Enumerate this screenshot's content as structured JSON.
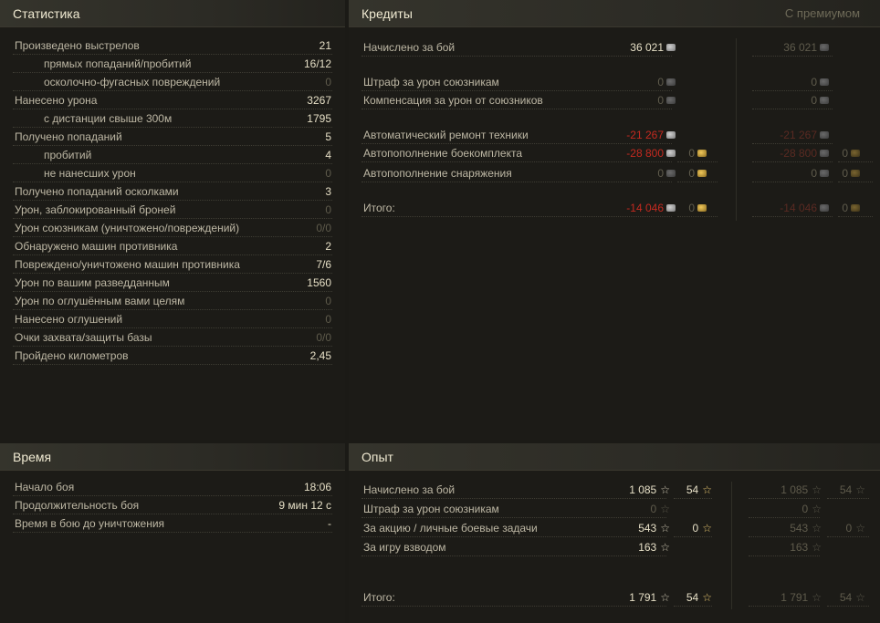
{
  "statistics": {
    "title": "Статистика",
    "rows": [
      {
        "label": "Произведено выстрелов",
        "value": "21",
        "sub": false,
        "zero": false
      },
      {
        "label": "прямых попаданий/пробитий",
        "value": "16/12",
        "sub": true,
        "zero": false
      },
      {
        "label": "осколочно-фугасных повреждений",
        "value": "0",
        "sub": true,
        "zero": true
      },
      {
        "label": "Нанесено урона",
        "value": "3267",
        "sub": false,
        "zero": false
      },
      {
        "label": "с дистанции свыше 300м",
        "value": "1795",
        "sub": true,
        "zero": false
      },
      {
        "label": "Получено попаданий",
        "value": "5",
        "sub": false,
        "zero": false
      },
      {
        "label": "пробитий",
        "value": "4",
        "sub": true,
        "zero": false
      },
      {
        "label": "не нанесших урон",
        "value": "0",
        "sub": true,
        "zero": true
      },
      {
        "label": "Получено попаданий осколками",
        "value": "3",
        "sub": false,
        "zero": false
      },
      {
        "label": "Урон, заблокированный броней",
        "value": "0",
        "sub": false,
        "zero": true
      },
      {
        "label": "Урон союзникам (уничтожено/повреждений)",
        "value": "0/0",
        "sub": false,
        "zero": true
      },
      {
        "label": "Обнаружено машин противника",
        "value": "2",
        "sub": false,
        "zero": false
      },
      {
        "label": "Повреждено/уничтожено машин противника",
        "value": "7/6",
        "sub": false,
        "zero": false
      },
      {
        "label": "Урон по вашим разведданным",
        "value": "1560",
        "sub": false,
        "zero": false
      },
      {
        "label": "Урон по оглушённым вами целям",
        "value": "0",
        "sub": false,
        "zero": true
      },
      {
        "label": "Нанесено оглушений",
        "value": "0",
        "sub": false,
        "zero": true
      },
      {
        "label": "Очки захвата/защиты базы",
        "value": "0/0",
        "sub": false,
        "zero": true
      },
      {
        "label": "Пройдено километров",
        "value": "2,45",
        "sub": false,
        "zero": false
      }
    ]
  },
  "time": {
    "title": "Время",
    "rows": [
      {
        "label": "Начало боя",
        "value": "18:06"
      },
      {
        "label": "Продолжительность боя",
        "value": "9 мин 12 с"
      },
      {
        "label": "Время в бою до уничтожения",
        "value": "-"
      }
    ]
  },
  "credits": {
    "title": "Кредиты",
    "premium_label": "С премиумом",
    "rows": [
      {
        "label": "Начислено за бой",
        "credits": "36 021",
        "credits_style": "w",
        "gold": null,
        "prem_credits": "36 021",
        "prem_style": "dim",
        "prem_gold": null
      },
      {
        "label": "Штраф за урон союзникам",
        "credits": "0",
        "credits_style": "dim",
        "gold": null,
        "prem_credits": "0",
        "prem_style": "dim",
        "prem_gold": null
      },
      {
        "label": "Компенсация за урон от союзников",
        "credits": "0",
        "credits_style": "dim",
        "gold": null,
        "prem_credits": "0",
        "prem_style": "dim",
        "prem_gold": null
      },
      {
        "label": "Автоматический ремонт техники",
        "credits": "-21 267",
        "credits_style": "red",
        "gold": null,
        "prem_credits": "-21 267",
        "prem_style": "dimred",
        "prem_gold": null
      },
      {
        "label": "Автопополнение боекомплекта",
        "credits": "-28 800",
        "credits_style": "red",
        "gold": "0",
        "prem_credits": "-28 800",
        "prem_style": "dimred",
        "prem_gold": "0"
      },
      {
        "label": "Автопополнение снаряжения",
        "credits": "0",
        "credits_style": "dim",
        "gold": "0",
        "prem_credits": "0",
        "prem_style": "dim",
        "prem_gold": "0"
      },
      {
        "label": "Итого:",
        "credits": "-14 046",
        "credits_style": "red",
        "gold": "0",
        "prem_credits": "-14 046",
        "prem_style": "dimred",
        "prem_gold": "0"
      }
    ]
  },
  "experience": {
    "title": "Опыт",
    "rows": [
      {
        "label": "Начислено за бой",
        "xp": "1 085",
        "xp_style": "w",
        "free": "54",
        "prem_xp": "1 085",
        "prem_free": "54"
      },
      {
        "label": "Штраф за урон союзникам",
        "xp": "0",
        "xp_style": "dim",
        "free": null,
        "prem_xp": "0",
        "prem_free": null
      },
      {
        "label": "За акцию / личные боевые задачи",
        "xp": "543",
        "xp_style": "w",
        "free": "0",
        "prem_xp": "543",
        "prem_free": "0"
      },
      {
        "label": "За игру взводом",
        "xp": "163",
        "xp_style": "w",
        "free": null,
        "prem_xp": "163",
        "prem_free": null
      },
      {
        "label": "Итого:",
        "xp": "1 791",
        "xp_style": "w",
        "free": "54",
        "prem_xp": "1 791",
        "prem_free": "54"
      }
    ]
  }
}
